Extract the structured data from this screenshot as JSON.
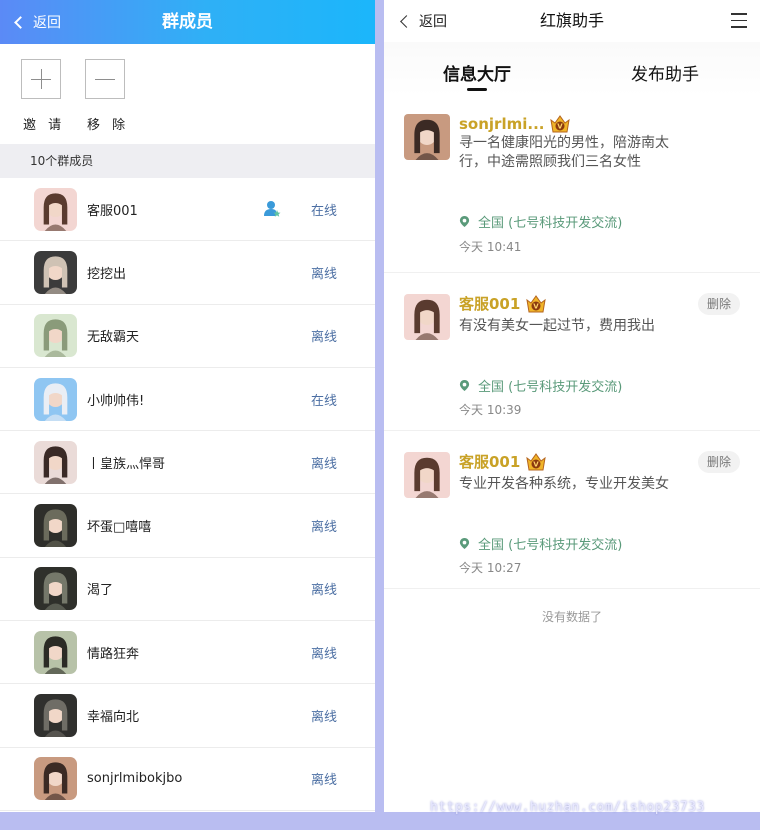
{
  "left": {
    "header": {
      "back_label": "返回",
      "title": "群成员"
    },
    "actions": {
      "invite_label": "邀 请",
      "remove_label": "移 除"
    },
    "section_label": "10个群成员",
    "members": [
      {
        "name": "客服001",
        "status": "在线",
        "role_icon": "user-star-icon",
        "avatar_colors": [
          "#f3d6d2",
          "#5a3b2f"
        ]
      },
      {
        "name": "挖挖出",
        "status": "离线",
        "avatar_colors": [
          "#3b3b3b",
          "#cfc2b4"
        ]
      },
      {
        "name": "无敌霸天",
        "status": "离线",
        "avatar_colors": [
          "#d9e7d0",
          "#8a9b7a"
        ]
      },
      {
        "name": "小帅帅伟!",
        "status": "在线",
        "avatar_colors": [
          "#8fc6f2",
          "#e9eef5"
        ]
      },
      {
        "name": "丨皇族灬悍哥",
        "status": "离线",
        "avatar_colors": [
          "#eadbd8",
          "#3a2a26"
        ]
      },
      {
        "name": "坏蛋□嘻嘻",
        "status": "离线",
        "avatar_colors": [
          "#2e2e2a",
          "#6b6b5c"
        ]
      },
      {
        "name": "渴了",
        "status": "离线",
        "avatar_colors": [
          "#2f302b",
          "#75786a"
        ]
      },
      {
        "name": "情路狂奔",
        "status": "离线",
        "avatar_colors": [
          "#b7c2a8",
          "#2b2b25"
        ]
      },
      {
        "name": "幸福向北",
        "status": "离线",
        "avatar_colors": [
          "#30302e",
          "#6f6d66"
        ]
      },
      {
        "name": "sonjrlmibokjbo",
        "status": "离线",
        "avatar_colors": [
          "#c89a80",
          "#3b2a24"
        ]
      }
    ]
  },
  "right": {
    "header": {
      "back_label": "返回",
      "title": "红旗助手",
      "menu_icon": "hamburger-menu-icon"
    },
    "tabs": [
      {
        "label": "信息大厅",
        "active": true
      },
      {
        "label": "发布助手",
        "active": false
      }
    ],
    "posts": [
      {
        "name": "sonjrlmi...",
        "text": "寻一名健康阳光的男性，陪游南太行，中途需照顾我们三名女性",
        "location": "全国 (七号科技开发交流)",
        "time": "今天 10:41",
        "delete_label": "",
        "avatar_colors": [
          "#c89a80",
          "#3b2a24"
        ]
      },
      {
        "name": "客服001",
        "text": "有没有美女一起过节，费用我出",
        "location": "全国 (七号科技开发交流)",
        "time": "今天 10:39",
        "delete_label": "删除",
        "avatar_colors": [
          "#f3d6d2",
          "#5a3b2f"
        ]
      },
      {
        "name": "客服001",
        "text": "专业开发各种系统，专业开发美女",
        "location": "全国 (七号科技开发交流)",
        "time": "今天 10:27",
        "delete_label": "删除",
        "avatar_colors": [
          "#f3d6d2",
          "#5a3b2f"
        ]
      }
    ],
    "no_more": "没有数据了",
    "accent_name_color": "#c9a227",
    "location_color": "#5a9a7a"
  },
  "watermark": "https://www.huzhan.com/ishop23733"
}
